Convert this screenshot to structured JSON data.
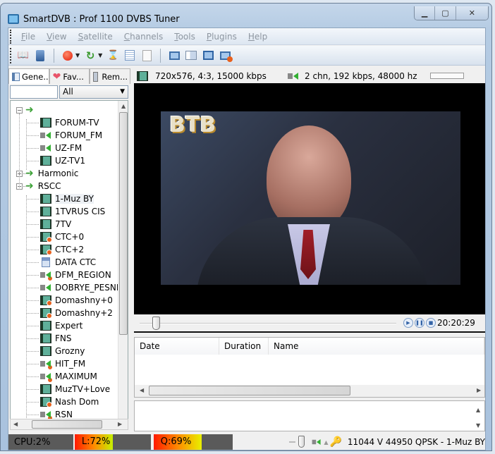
{
  "window": {
    "title": "SmartDVB : Prof 1100 DVBS Tuner",
    "controls": [
      "minimize",
      "maximize",
      "close"
    ]
  },
  "menu": [
    {
      "label": "File",
      "accel": "F"
    },
    {
      "label": "View",
      "accel": "V"
    },
    {
      "label": "Satellite",
      "accel": "S"
    },
    {
      "label": "Channels",
      "accel": "C"
    },
    {
      "label": "Tools",
      "accel": "T"
    },
    {
      "label": "Plugins",
      "accel": "P"
    },
    {
      "label": "Help",
      "accel": "H"
    }
  ],
  "toolbar": [
    "book-icon",
    "tablet-icon",
    "record-icon",
    "refresh-icon",
    "hourglass-icon",
    "list-icon",
    "document-icon",
    "monitor-icon",
    "layout-icon",
    "window-icon",
    "monitor-record-icon"
  ],
  "tabs": [
    {
      "label": "Gene...",
      "icon": "window-icon"
    },
    {
      "label": "Fav...",
      "icon": "heart-icon"
    },
    {
      "label": "Rem...",
      "icon": "remote-icon"
    }
  ],
  "filter": {
    "value": "",
    "select": "All"
  },
  "tree": [
    {
      "level": 0,
      "label": "",
      "type": "group",
      "expanded": true
    },
    {
      "level": 1,
      "label": "FORUM-TV",
      "type": "tv"
    },
    {
      "level": 1,
      "label": "FORUM_FM",
      "type": "radio"
    },
    {
      "level": 1,
      "label": "UZ-FM",
      "type": "radio"
    },
    {
      "level": 1,
      "label": "UZ-TV1",
      "type": "tv"
    },
    {
      "level": 0,
      "label": "Harmonic",
      "type": "group",
      "expanded": false
    },
    {
      "level": 0,
      "label": "RSCC",
      "type": "group",
      "expanded": true
    },
    {
      "level": 1,
      "label": "1-Muz BY",
      "type": "tv",
      "selected": true
    },
    {
      "level": 1,
      "label": "1TVRUS CIS",
      "type": "tv"
    },
    {
      "level": 1,
      "label": "7TV",
      "type": "tv"
    },
    {
      "level": 1,
      "label": "CTC+0",
      "type": "tv-lock"
    },
    {
      "level": 1,
      "label": "CTC+2",
      "type": "tv-lock"
    },
    {
      "level": 1,
      "label": "DATA CTC",
      "type": "data"
    },
    {
      "level": 1,
      "label": "DFM_REGION",
      "type": "radio-lock"
    },
    {
      "level": 1,
      "label": "DOBRYE_PESNI",
      "type": "radio"
    },
    {
      "level": 1,
      "label": "Domashny+0",
      "type": "tv-lock"
    },
    {
      "level": 1,
      "label": "Domashny+2",
      "type": "tv-lock"
    },
    {
      "level": 1,
      "label": "Expert",
      "type": "tv"
    },
    {
      "level": 1,
      "label": "FNS",
      "type": "tv"
    },
    {
      "level": 1,
      "label": "Grozny",
      "type": "tv"
    },
    {
      "level": 1,
      "label": "HIT_FM",
      "type": "radio-lock"
    },
    {
      "level": 1,
      "label": "MAXIMUM",
      "type": "radio-lock"
    },
    {
      "level": 1,
      "label": "MuzTV+Love",
      "type": "tv"
    },
    {
      "level": 1,
      "label": "Nash Dom",
      "type": "tv-lock"
    },
    {
      "level": 1,
      "label": "RSN",
      "type": "radio-lock"
    }
  ],
  "info": {
    "video": "720x576, 4:3, 15000 kbps",
    "audio": "2 chn, 192 kbps, 48000 hz"
  },
  "player": {
    "logo": "BTB",
    "time": "20:20:29",
    "position": 0.05
  },
  "recordings": {
    "columns": [
      "Date",
      "Duration",
      "Name"
    ],
    "rows": []
  },
  "status": {
    "cpu": "CPU:2%",
    "level": "L:72%",
    "quality": "Q:69%",
    "level_value": 72,
    "quality_value": 69,
    "volume": 1.0,
    "transponder": "11044 V 44950 QPSK - 1-Muz BY"
  },
  "colors": {
    "status_bg": "#5a5a5a",
    "signal_low": "#ff1a00",
    "signal_high": "#c6f000"
  }
}
